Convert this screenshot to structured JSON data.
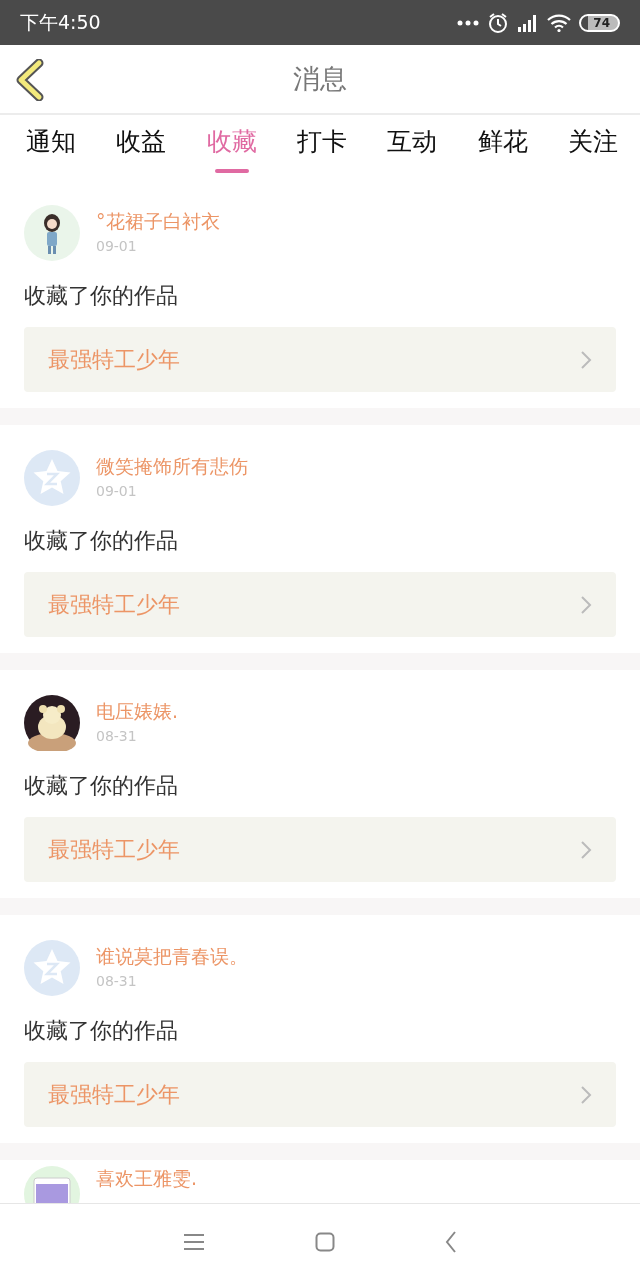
{
  "status_bar": {
    "time": "下午4:50",
    "battery": "74"
  },
  "header": {
    "title": "消息"
  },
  "tabs": [
    {
      "label": "通知",
      "selected": false
    },
    {
      "label": "收益",
      "selected": false
    },
    {
      "label": "收藏",
      "selected": true
    },
    {
      "label": "打卡",
      "selected": false
    },
    {
      "label": "互动",
      "selected": false
    },
    {
      "label": "鲜花",
      "selected": false
    },
    {
      "label": "关注",
      "selected": false
    }
  ],
  "messages": [
    {
      "avatar": {
        "kind": "figure"
      },
      "user": "°花裙子白衬衣",
      "date": "09-01",
      "text": "收藏了你的作品",
      "work": "最强特工少年"
    },
    {
      "avatar": {
        "kind": "default"
      },
      "user": "微笑掩饰所有悲伤",
      "date": "09-01",
      "text": "收藏了你的作品",
      "work": "最强特工少年"
    },
    {
      "avatar": {
        "kind": "toy"
      },
      "user": "电压婊婊.",
      "date": "08-31",
      "text": "收藏了你的作品",
      "work": "最强特工少年"
    },
    {
      "avatar": {
        "kind": "default"
      },
      "user": "谁说莫把青春误。",
      "date": "08-31",
      "text": "收藏了你的作品",
      "work": "最强特工少年"
    },
    {
      "avatar": {
        "kind": "cup"
      },
      "user": "喜欢王雅雯."
    }
  ]
}
